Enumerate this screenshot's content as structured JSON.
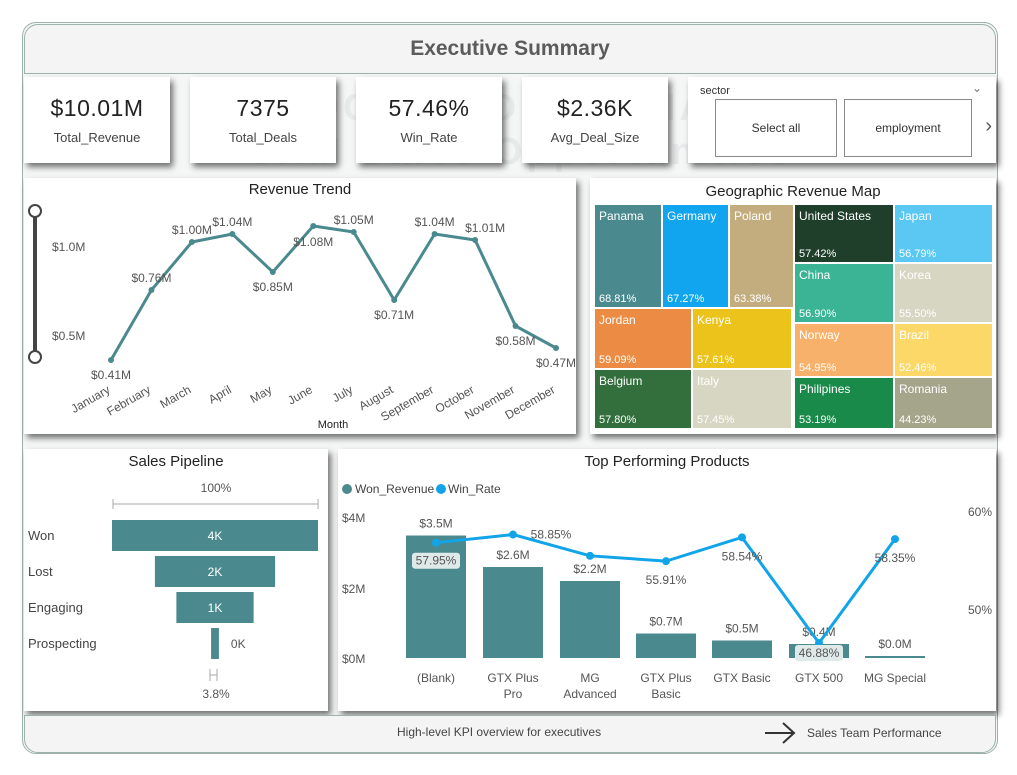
{
  "header": {
    "title": "Executive Summary"
  },
  "watermark": {
    "line1": "ASSOCIATE DATA ANALYST",
    "line2": "CRM Sales Opportunities"
  },
  "kpis": [
    {
      "value": "$10.01M",
      "label": "Total_Revenue"
    },
    {
      "value": "7375",
      "label": "Total_Deals"
    },
    {
      "value": "57.46%",
      "label": "Win_Rate"
    },
    {
      "value": "$2.36K",
      "label": "Avg_Deal_Size"
    }
  ],
  "slicer": {
    "title": "sector",
    "options": [
      "Select all",
      "employment"
    ]
  },
  "revenue_trend": {
    "title": "Revenue Trend",
    "xlabel": "Month",
    "y_ticks": [
      "$1.0M",
      "$0.5M"
    ],
    "chart_data": {
      "type": "line",
      "categories": [
        "January",
        "February",
        "March",
        "April",
        "May",
        "June",
        "July",
        "August",
        "September",
        "October",
        "November",
        "December"
      ],
      "values": [
        0.41,
        0.76,
        1.0,
        1.04,
        0.85,
        1.08,
        1.05,
        0.71,
        1.04,
        1.01,
        0.58,
        0.47
      ],
      "labels": [
        "$0.41M",
        "$0.76M",
        "$1.00M",
        "$1.04M",
        "$0.85M",
        "$1.08M",
        "$1.05M",
        "$0.71M",
        "$1.04M",
        "$1.01M",
        "$0.58M",
        "$0.47M"
      ],
      "ylim": [
        0.3,
        1.2
      ],
      "xlabel": "Month",
      "color": "#4a8a8f"
    }
  },
  "geo_map": {
    "title": "Geographic Revenue Map",
    "cells": [
      {
        "name": "Panama",
        "pct": "68.81%",
        "color": "#4a8a8f",
        "text": "#ffffff"
      },
      {
        "name": "Germany",
        "pct": "67.27%",
        "color": "#10a5ee",
        "text": "#ffffff"
      },
      {
        "name": "Poland",
        "pct": "63.38%",
        "color": "#c3ad7e",
        "text": "#ffffff"
      },
      {
        "name": "United States",
        "pct": "57.42%",
        "color": "#1f3f2a",
        "text": "#ffffff"
      },
      {
        "name": "Japan",
        "pct": "56.79%",
        "color": "#5ac8f2",
        "text": "#ffffff"
      },
      {
        "name": "China",
        "pct": "56.90%",
        "color": "#3bb395",
        "text": "#ffffff"
      },
      {
        "name": "Korea",
        "pct": "55.50%",
        "color": "#d6d6c3",
        "text": "#ffffff"
      },
      {
        "name": "Jordan",
        "pct": "59.09%",
        "color": "#ec8c44",
        "text": "#ffffff"
      },
      {
        "name": "Kenya",
        "pct": "57.61%",
        "color": "#ebc31a",
        "text": "#ffffff"
      },
      {
        "name": "Norway",
        "pct": "54.95%",
        "color": "#f8b16a",
        "text": "#ffffff"
      },
      {
        "name": "Brazil",
        "pct": "52.46%",
        "color": "#fbd868",
        "text": "#ffffff"
      },
      {
        "name": "Belgium",
        "pct": "57.80%",
        "color": "#326f3c",
        "text": "#ffffff"
      },
      {
        "name": "Italy",
        "pct": "57.45%",
        "color": "#d6d6c3",
        "text": "#ffffff"
      },
      {
        "name": "Philipines",
        "pct": "53.19%",
        "color": "#1a8a4a",
        "text": "#ffffff"
      },
      {
        "name": "Romania",
        "pct": "44.23%",
        "color": "#a5a58b",
        "text": "#ffffff"
      }
    ]
  },
  "pipeline": {
    "title": "Sales Pipeline",
    "top_label": "100%",
    "bottom_label": "3.8%",
    "chart_data": {
      "type": "bar",
      "categories": [
        "Won",
        "Lost",
        "Engaging",
        "Prospecting"
      ],
      "values": [
        4238,
        2473,
        1589,
        161
      ],
      "labels": [
        "4K",
        "2K",
        "1K",
        "0K"
      ],
      "color": "#4a8a8f"
    }
  },
  "products": {
    "title": "Top Performing Products",
    "legend": [
      "Won_Revenue",
      "Win_Rate"
    ],
    "y_left_ticks": [
      "$4M",
      "$2M",
      "$0M"
    ],
    "y_right_ticks": [
      "60%",
      "50%"
    ],
    "chart_data": {
      "type": "bar",
      "categories": [
        "(Blank)",
        "GTX Plus Pro",
        "MG Advanced",
        "GTX Plus Basic",
        "GTX Basic",
        "GTX 500",
        "MG Special"
      ],
      "series": [
        {
          "name": "Won_Revenue",
          "values": [
            3.5,
            2.6,
            2.2,
            0.7,
            0.5,
            0.4,
            0.0
          ],
          "labels": [
            "$3.5M",
            "$2.6M",
            "$2.2M",
            "$0.7M",
            "$0.5M",
            "$0.4M",
            "$0.0M"
          ],
          "color": "#4a8a8f"
        },
        {
          "name": "Win_Rate",
          "values": [
            57.95,
            58.85,
            56.5,
            55.91,
            58.54,
            46.88,
            58.35
          ],
          "labels": [
            "57.95%",
            "58.85%",
            "",
            "55.91%",
            "58.54%",
            "46.88%",
            "58.35%"
          ],
          "color": "#12a4e8"
        }
      ],
      "ylim_left": [
        0,
        4
      ],
      "ylim_right": [
        45,
        62
      ]
    }
  },
  "footer": {
    "text": "High-level KPI overview for executives",
    "link": "Sales Team Performance"
  }
}
